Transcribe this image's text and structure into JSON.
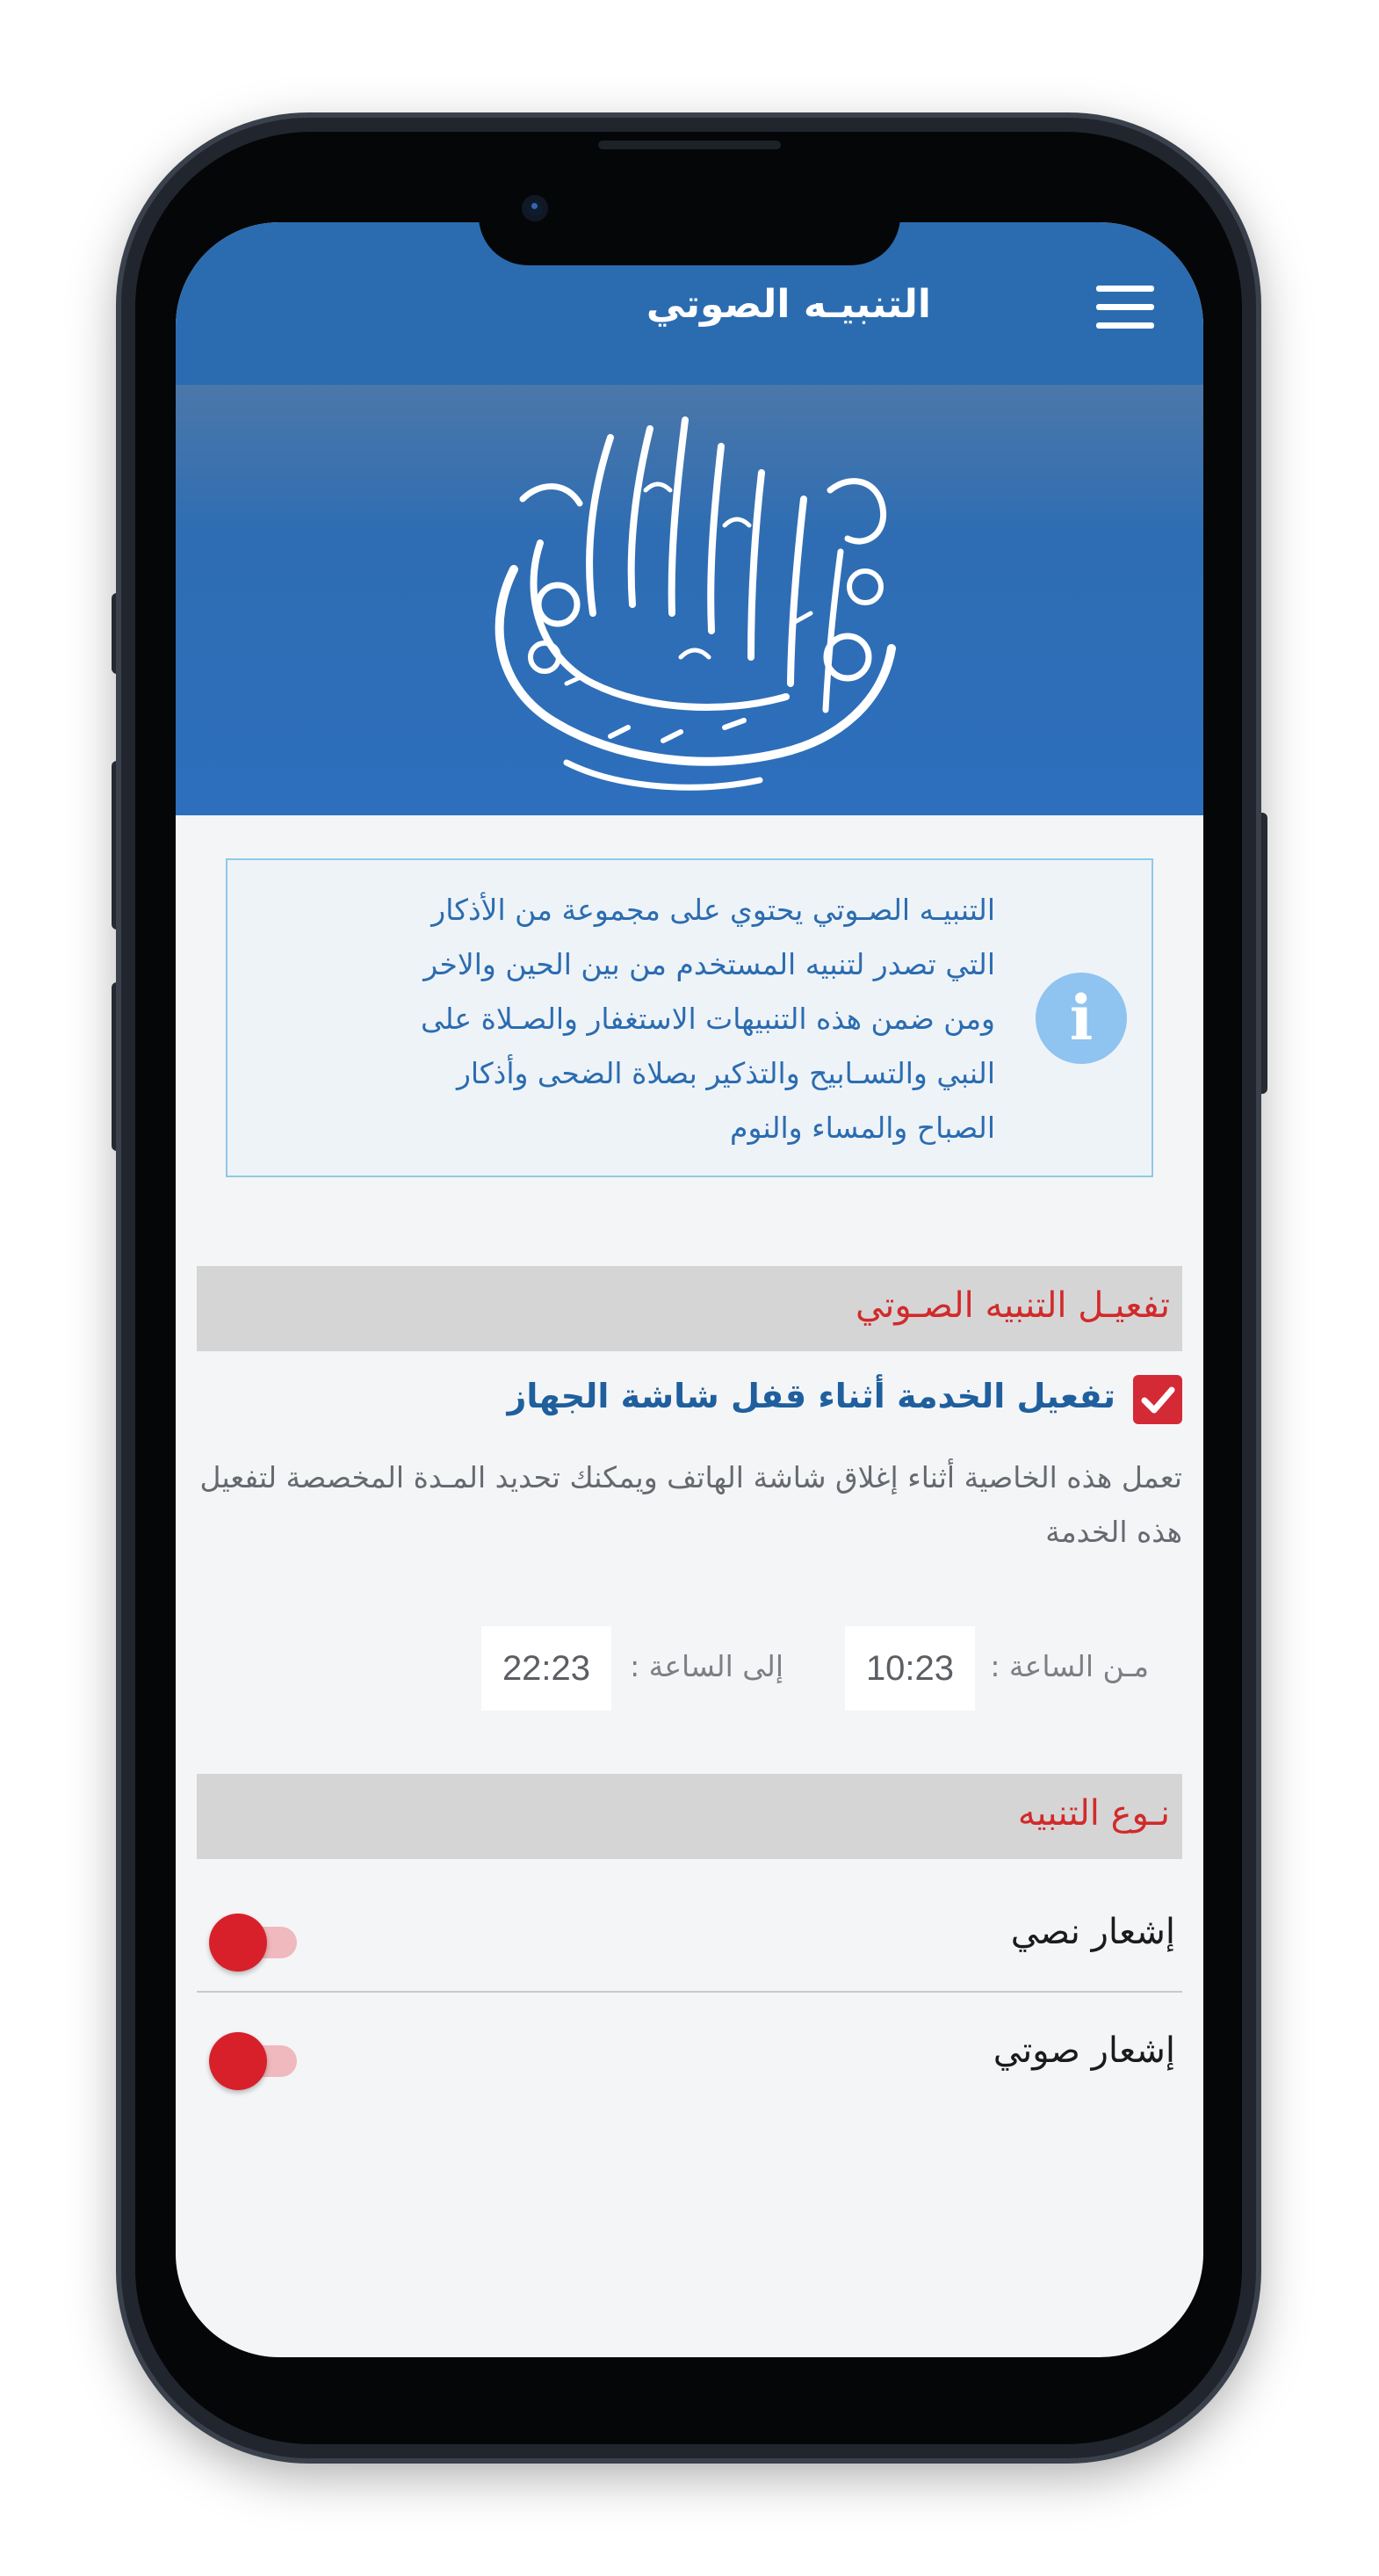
{
  "app_bar": {
    "title": "التنبيـه الصوتي",
    "menu_icon": "hamburger-menu-icon"
  },
  "banner": {
    "calligraphy_text": "ألا بذكر الله تطمئن القلوب"
  },
  "info": {
    "icon": "info-icon",
    "icon_glyph": "i",
    "lines": [
      "التنبيـه الصـوتي يحتوي على مجموعة من الأذكار",
      "التي تصدر لتنبيه المستخدم من بين الحين والاخر",
      "ومن ضمن هذه التنبيهات الاستغفار والصـلاة على",
      "النبي والتسـابيح والتذكير بصلاة الضحى وأذكار",
      "الصباح والمساء والنوم"
    ]
  },
  "activation_section": {
    "header": "تفعيـل التنبيه الصـوتي",
    "lock_screen": {
      "checked": true,
      "title": "تفعيل الخدمة أثناء قفل شاشة الجهاز",
      "description": "تعمل هذه الخاصية أثناء إغلاق شاشة الهاتف ويمكنك تحديد المـدة المخصصة لتفعيل هذه الخدمة"
    },
    "time_range": {
      "from_label": "مـن الساعة :",
      "from_value": "10:23",
      "to_label": "إلى الساعة :",
      "to_value": "22:23"
    }
  },
  "type_section": {
    "header": "نـوع التنبيه",
    "options": [
      {
        "label": "إشعار نصي",
        "enabled": true
      },
      {
        "label": "إشعار صوتي",
        "enabled": true
      }
    ]
  },
  "colors": {
    "primary_blue": "#2b6cb0",
    "accent_red": "#d22a2a",
    "info_background": "#eef3f8"
  }
}
